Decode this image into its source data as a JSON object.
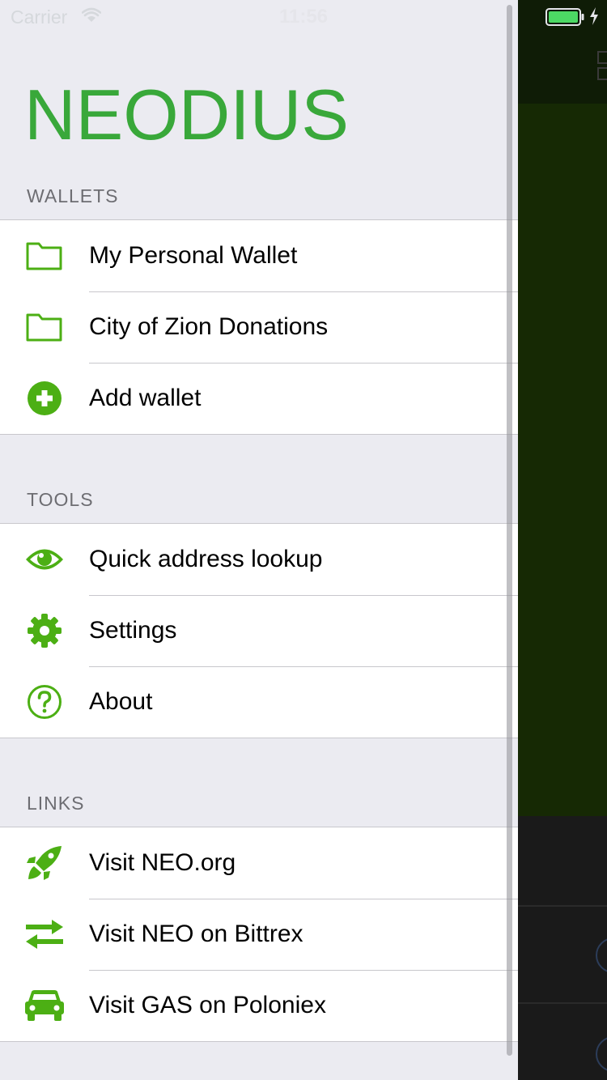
{
  "status_bar": {
    "carrier": "Carrier",
    "time": "11:56"
  },
  "drawer": {
    "brand": "NEODIUS",
    "sections": [
      {
        "title": "WALLETS",
        "items": [
          {
            "label": "My Personal Wallet",
            "icon": "folder-icon"
          },
          {
            "label": "City of Zion Donations",
            "icon": "folder-icon"
          },
          {
            "label": "Add wallet",
            "icon": "plus-circle-icon"
          }
        ]
      },
      {
        "title": "TOOLS",
        "items": [
          {
            "label": "Quick address lookup",
            "icon": "eye-icon"
          },
          {
            "label": "Settings",
            "icon": "gear-icon"
          },
          {
            "label": "About",
            "icon": "question-circle-icon"
          }
        ]
      },
      {
        "title": "LINKS",
        "items": [
          {
            "label": "Visit NEO.org",
            "icon": "rocket-icon"
          },
          {
            "label": "Visit NEO on Bittrex",
            "icon": "exchange-icon"
          },
          {
            "label": "Visit GAS on Poloniex",
            "icon": "car-icon"
          }
        ]
      }
    ]
  },
  "colors": {
    "accent": "#39a83a",
    "icon_green": "#4caf14",
    "drawer_bg": "#ebebf1",
    "battery": "#4cd964"
  }
}
